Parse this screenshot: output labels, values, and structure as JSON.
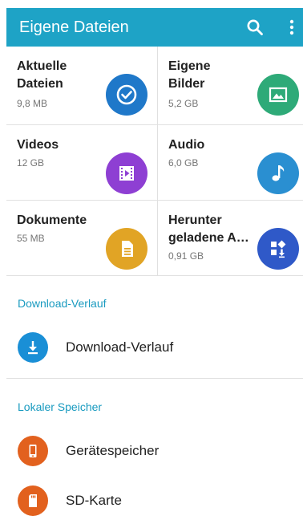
{
  "appbar": {
    "title": "Eigene Dateien",
    "color": "#1ea3c6",
    "icons": [
      "search-icon",
      "more-vert-icon"
    ]
  },
  "categories": [
    {
      "name": "Aktuelle\nDateien",
      "size": "9,8 MB",
      "icon": "clock-check-icon",
      "color": "#1f78c9"
    },
    {
      "name": "Eigene\nBilder",
      "size": "5,2 GB",
      "icon": "image-icon",
      "color": "#2eaa78"
    },
    {
      "name": "Videos",
      "size": "12 GB",
      "icon": "video-icon",
      "color": "#8e3fd3"
    },
    {
      "name": "Audio",
      "size": "6,0 GB",
      "icon": "music-note-icon",
      "color": "#2a8fd1"
    },
    {
      "name": "Dokumente",
      "size": "55 MB",
      "icon": "document-icon",
      "color": "#e1a425"
    },
    {
      "name": "Herunter\ngeladene A…",
      "size": "0,91 GB",
      "icon": "downloaded-apps-icon",
      "color": "#2f59c8"
    }
  ],
  "sections": {
    "download_header": "Download-Verlauf",
    "download_item": "Download-Verlauf",
    "storage_header": "Lokaler Speicher",
    "device_storage": "Gerätespeicher",
    "sd_card": "SD-Karte"
  },
  "colors": {
    "download_icon": "#1a8fd6",
    "storage_icon": "#e2611e",
    "section_header": "#1a9bc0"
  }
}
